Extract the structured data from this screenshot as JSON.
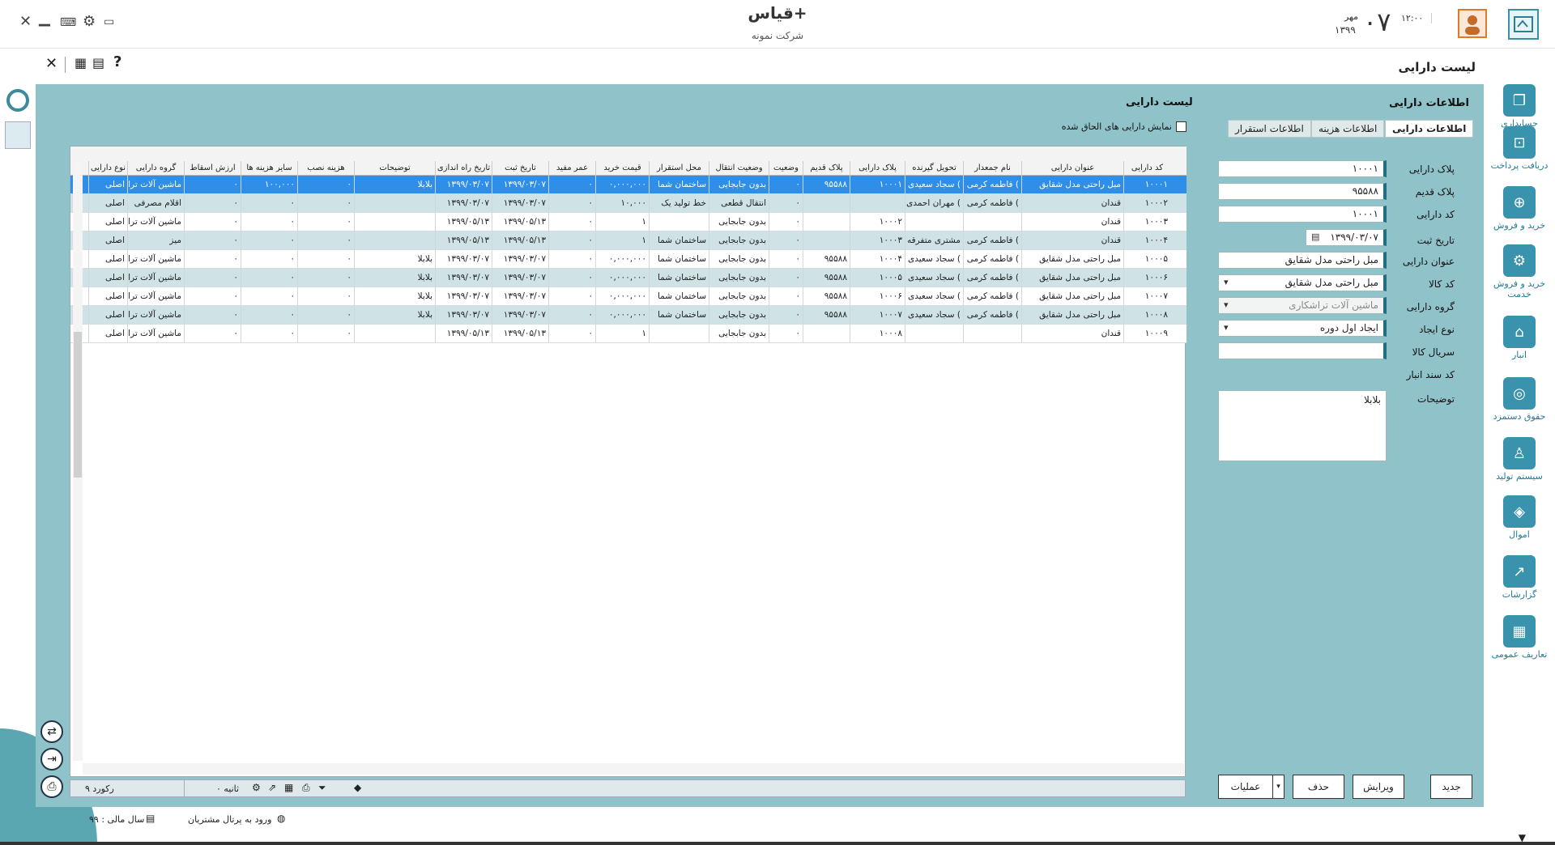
{
  "window": {
    "app_title": "قیاس+",
    "company": "شرکت نمونه",
    "day": "۰۷",
    "month": "مهر",
    "year": "۱۳۹۹",
    "clock": "۱۲:۰۰"
  },
  "subbar": {
    "page_title": "لیست دارایی"
  },
  "sidebar": {
    "items": [
      {
        "label": "حسابداری",
        "icon": "accounting-icon"
      },
      {
        "label": "دریافت پرداخت",
        "icon": "payment-icon"
      },
      {
        "label": "خرید و فروش",
        "icon": "buy-sell-icon"
      },
      {
        "label": "خرید و فروش خدمت",
        "icon": "service-gear-icon"
      },
      {
        "label": "انبار",
        "icon": "warehouse-icon"
      },
      {
        "label": "حقوق دستمزد",
        "icon": "payroll-icon"
      },
      {
        "label": "سیستم تولید",
        "icon": "production-icon"
      },
      {
        "label": "اموال",
        "icon": "assets-icon"
      },
      {
        "label": "گزارشات",
        "icon": "reports-icon"
      },
      {
        "label": "تعاریف عمومی",
        "icon": "definitions-icon"
      }
    ]
  },
  "form": {
    "title": "اطلاعات دارایی",
    "tabs": [
      "اطلاعات دارایی",
      "اطلاعات هزینه",
      "اطلاعات استقرار"
    ],
    "labels": {
      "plate": "پلاک دارایی",
      "old_plate": "پلاک قدیم",
      "asset_code": "کد دارایی",
      "reg_date": "تاریخ ثبت",
      "asset_title": "عنوان دارایی",
      "item_code": "کد کالا",
      "asset_group": "گروه دارایی",
      "creation_type": "نوع ایجاد",
      "serial": "سریال کالا",
      "store_doc": "کد سند انبار",
      "description": "توضیحات"
    },
    "values": {
      "plate": "۱۰۰۰۱",
      "old_plate": "۹۵۵۸۸",
      "asset_code": "۱۰۰۰۱",
      "reg_date": "۱۳۹۹/۰۳/۰۷",
      "asset_title": "مبل راحتی مدل شقایق",
      "item_code": "مبل راحتی مدل شقایق",
      "asset_group": "ماشین آلات تراشکاری",
      "creation_type": "ایجاد اول دوره",
      "serial": "",
      "description": "بلابلا"
    },
    "buttons": {
      "new": "جدید",
      "edit": "ویرایش",
      "delete": "حذف",
      "operations": "عملیات"
    }
  },
  "list": {
    "title": "لیست دارایی",
    "show_attached": "نمایش دارایی های الحاق شده",
    "columns": [
      "کد دارایی",
      "عنوان دارایی",
      "نام جمعدار",
      "تحویل گیرنده",
      "پلاک دارایی",
      "پلاک قدیم",
      "وضعیت",
      "وضعیت انتقال",
      "محل استقرار",
      "قیمت خرید",
      "عمر مفید",
      "تاریخ ثبت",
      "تاریخ راه اندازی",
      "توضیحات",
      "هزینه نصب",
      "سایر هزینه ها",
      "ارزش اسقاط",
      "گروه دارایی",
      "نوع دارایی"
    ],
    "rows": [
      [
        "۱۰۰۰۱",
        "مبل راحتی مدل شقایق",
        "فاطمه کرمی (",
        "سجاد سعیدی (",
        "۱۰۰۰۱",
        "۹۵۵۸۸",
        "۰",
        "بدون جابجایی",
        "ساختمان شما",
        "۰,۰۰۰,۰۰۰",
        "۰",
        "۱۳۹۹/۰۳/۰۷",
        "۱۳۹۹/۰۳/۰۷",
        "بلابلا",
        "۰",
        "۱۰۰,۰۰۰",
        "۰",
        "ماشین آلات ترا",
        "اصلی"
      ],
      [
        "۱۰۰۰۲",
        "قندان",
        "فاطمه کرمی (",
        "مهران احمدی (",
        "",
        "",
        "۰",
        "انتقال قطعی",
        "خط تولید یک",
        "۱۰,۰۰۰",
        "۰",
        "۱۳۹۹/۰۳/۰۷",
        "۱۳۹۹/۰۳/۰۷",
        "",
        "۰",
        "۰",
        "۰",
        "اقلام مصرفی",
        "اصلی"
      ],
      [
        "۱۰۰۰۳",
        "قندان",
        "",
        "",
        "۱۰۰۰۲",
        "",
        "۰",
        "بدون جابجایی",
        "",
        "۱",
        "۰",
        "۱۳۹۹/۰۵/۱۳",
        "۱۳۹۹/۰۵/۱۳",
        "",
        "۰",
        "۰",
        "۰",
        "ماشین آلات ترا",
        "اصلی"
      ],
      [
        "۱۰۰۰۴",
        "قندان",
        "فاطمه کرمی (",
        "مشتری متفرقه",
        "۱۰۰۰۳",
        "",
        "۰",
        "بدون جابجایی",
        "ساختمان شما",
        "۱",
        "۰",
        "۱۳۹۹/۰۵/۱۳",
        "۱۳۹۹/۰۵/۱۳",
        "",
        "۰",
        "۰",
        "۰",
        "میز",
        "اصلی"
      ],
      [
        "۱۰۰۰۵",
        "مبل راحتی مدل شقایق",
        "فاطمه کرمی (",
        "سجاد سعیدی (",
        "۱۰۰۰۴",
        "۹۵۵۸۸",
        "۰",
        "بدون جابجایی",
        "ساختمان شما",
        "۰,۰۰۰,۰۰۰",
        "۰",
        "۱۳۹۹/۰۳/۰۷",
        "۱۳۹۹/۰۳/۰۷",
        "بلابلا",
        "۰",
        "۰",
        "۰",
        "ماشین آلات ترا",
        "اصلی"
      ],
      [
        "۱۰۰۰۶",
        "مبل راحتی مدل شقایق",
        "فاطمه کرمی (",
        "سجاد سعیدی (",
        "۱۰۰۰۵",
        "۹۵۵۸۸",
        "۰",
        "بدون جابجایی",
        "ساختمان شما",
        "۰,۰۰۰,۰۰۰",
        "۰",
        "۱۳۹۹/۰۳/۰۷",
        "۱۳۹۹/۰۳/۰۷",
        "بلابلا",
        "۰",
        "۰",
        "۰",
        "ماشین آلات ترا",
        "اصلی"
      ],
      [
        "۱۰۰۰۷",
        "مبل راحتی مدل شقایق",
        "فاطمه کرمی (",
        "سجاد سعیدی (",
        "۱۰۰۰۶",
        "۹۵۵۸۸",
        "۰",
        "بدون جابجایی",
        "ساختمان شما",
        "۰,۰۰۰,۰۰۰",
        "۰",
        "۱۳۹۹/۰۳/۰۷",
        "۱۳۹۹/۰۳/۰۷",
        "بلابلا",
        "۰",
        "۰",
        "۰",
        "ماشین آلات ترا",
        "اصلی"
      ],
      [
        "۱۰۰۰۸",
        "مبل راحتی مدل شقایق",
        "فاطمه کرمی (",
        "سجاد سعیدی (",
        "۱۰۰۰۷",
        "۹۵۵۸۸",
        "۰",
        "بدون جابجایی",
        "ساختمان شما",
        "۰,۰۰۰,۰۰۰",
        "۰",
        "۱۳۹۹/۰۳/۰۷",
        "۱۳۹۹/۰۳/۰۷",
        "بلابلا",
        "۰",
        "۰",
        "۰",
        "ماشین آلات ترا",
        "اصلی"
      ],
      [
        "۱۰۰۰۹",
        "قندان",
        "",
        "",
        "۱۰۰۰۸",
        "",
        "۰",
        "بدون جابجایی",
        "",
        "۱",
        "۰",
        "۱۳۹۹/۰۵/۱۳",
        "۱۳۹۹/۰۵/۱۳",
        "",
        "۰",
        "۰",
        "۰",
        "ماشین آلات ترا",
        "اصلی"
      ]
    ],
    "footer": {
      "record_count": "۹ رکورد",
      "seconds": "۰ ثانیه"
    }
  },
  "status": {
    "fiscal_year": "سال مالی : ۹۹",
    "portal": "ورود به پرتال مشتریان"
  },
  "colors": {
    "panel": "#8fc3c9",
    "accent": "#1e6f82",
    "selected_row": "#2f8ee8",
    "alt_row": "#cfe3e6"
  }
}
